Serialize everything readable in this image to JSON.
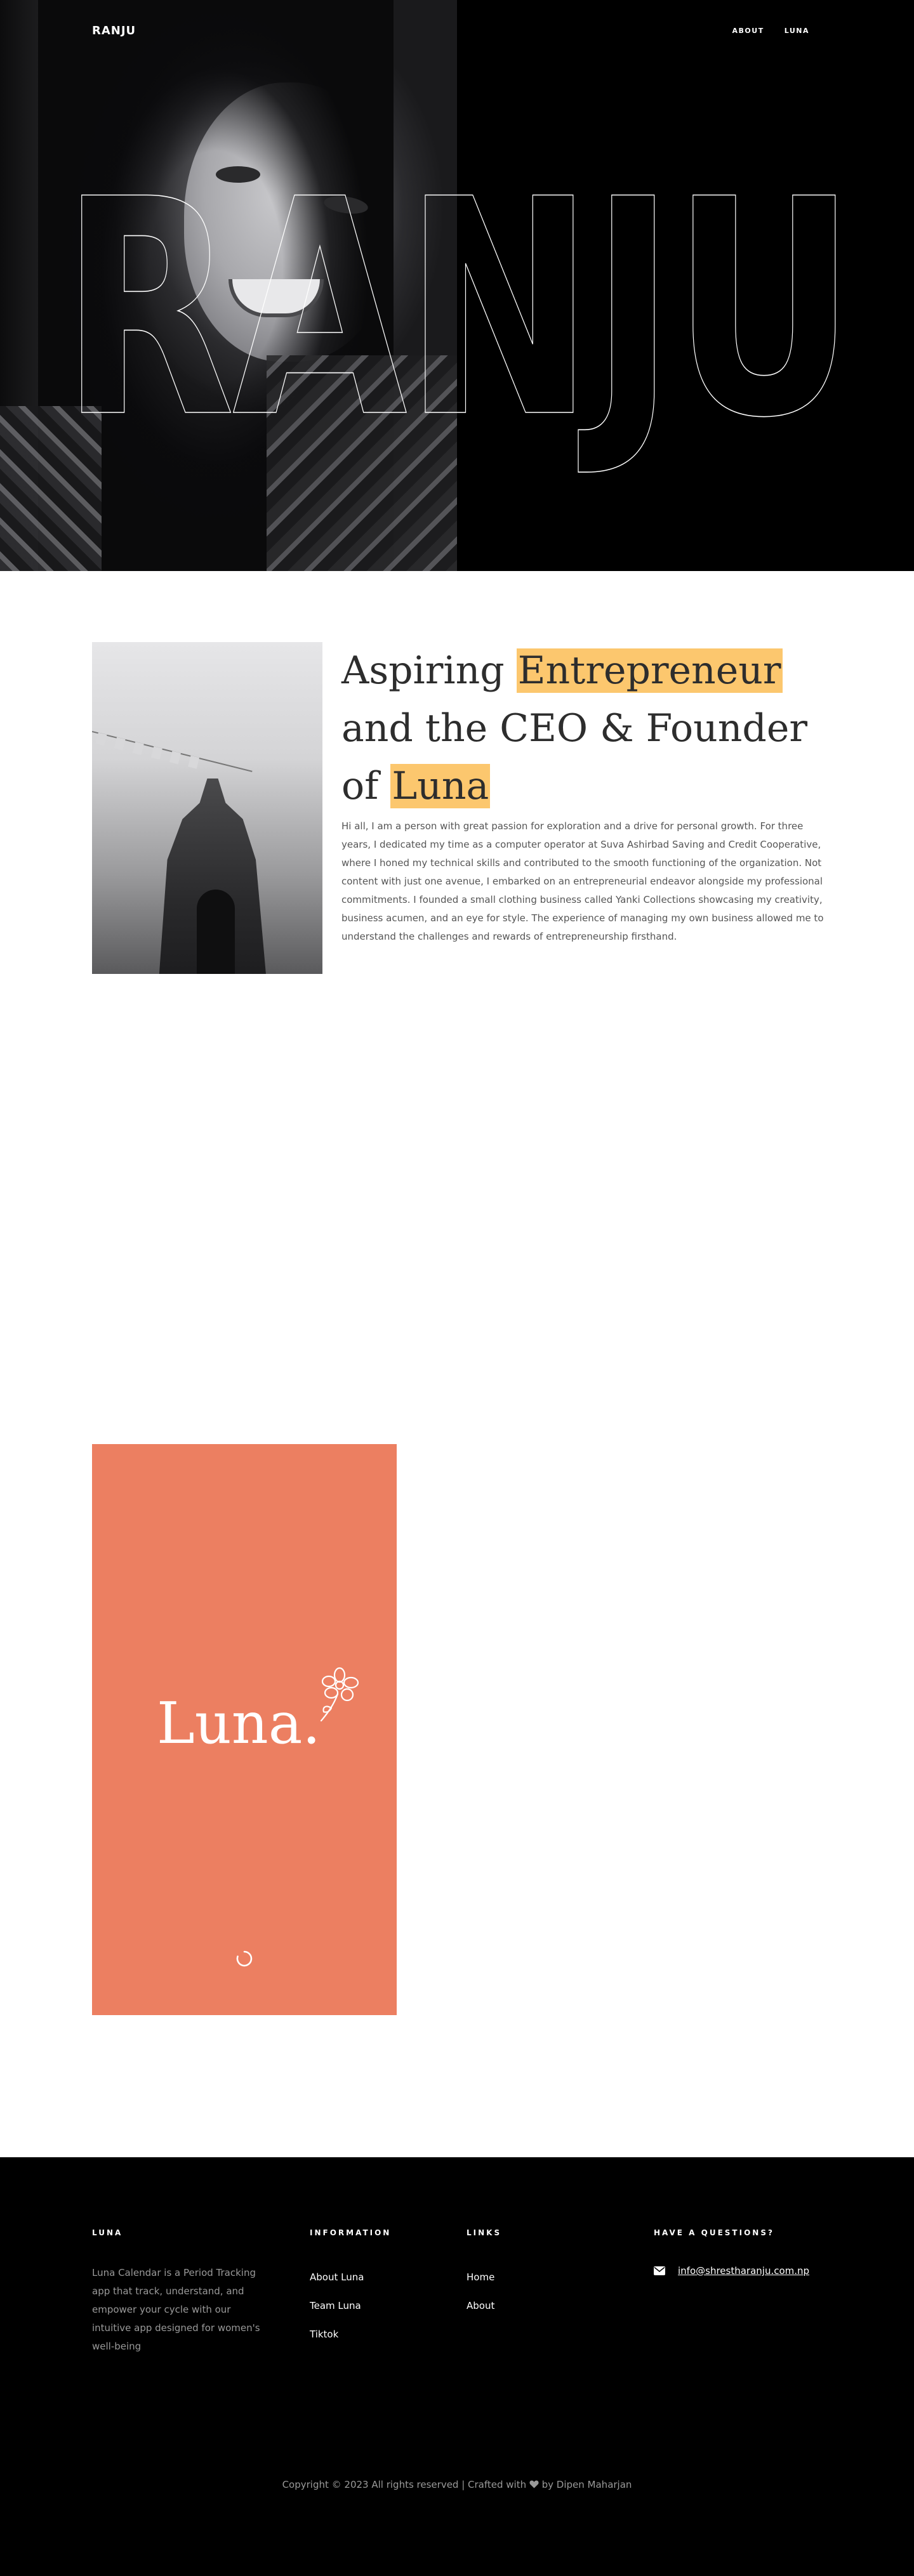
{
  "nav": {
    "brand": "RANJU",
    "links": [
      "ABOUT",
      "LUNA"
    ]
  },
  "hero": {
    "outline_word": "RANJU",
    "photo_alt": "Portrait of Ranju"
  },
  "about": {
    "title_part1": "Aspiring ",
    "title_highlight1": "Entrepreneur",
    "title_part2": " and the CEO & Founder of ",
    "title_highlight2": "Luna",
    "body": "Hi all, I am a person with great passion for exploration and a drive for personal growth. For three years, I dedicated my time as a computer operator at Suva Ashirbad Saving and Credit Cooperative, where I honed my technical skills and contributed to the smooth functioning of the organization. Not content with just one avenue, I embarked on an entrepreneurial endeavor alongside my professional commitments. I founded a small clothing business called Yanki Collections showcasing my creativity, business acumen, and an eye for style. The experience of managing my own business allowed me to understand the challenges and rewards of entrepreneurship firsthand."
  },
  "luna_card": {
    "logo_text": "Luna.",
    "bg_color": "#ec7f61",
    "icons": [
      "flower-icon",
      "loading-spinner-icon"
    ]
  },
  "footer": {
    "col1": {
      "heading": "LUNA",
      "description": "Luna Calendar is a Period Tracking app that track, understand, and empower your cycle with our intuitive app designed for women's well-being"
    },
    "col2": {
      "heading": "INFORMATION",
      "links": [
        "About Luna",
        "Team Luna",
        "Tiktok"
      ]
    },
    "col3": {
      "heading": "LINKS",
      "links": [
        "Home",
        "About"
      ]
    },
    "col4": {
      "heading": "HAVE A QUESTIONS?",
      "email": "info@shrestharanju.com.np"
    },
    "copyright_prefix": "Copyright © 2023 All rights reserved | Crafted with ",
    "copyright_suffix": " by Dipen Maharjan"
  },
  "colors": {
    "highlight": "#fcc76e",
    "luna": "#ec7f61",
    "dark": "#000000"
  }
}
